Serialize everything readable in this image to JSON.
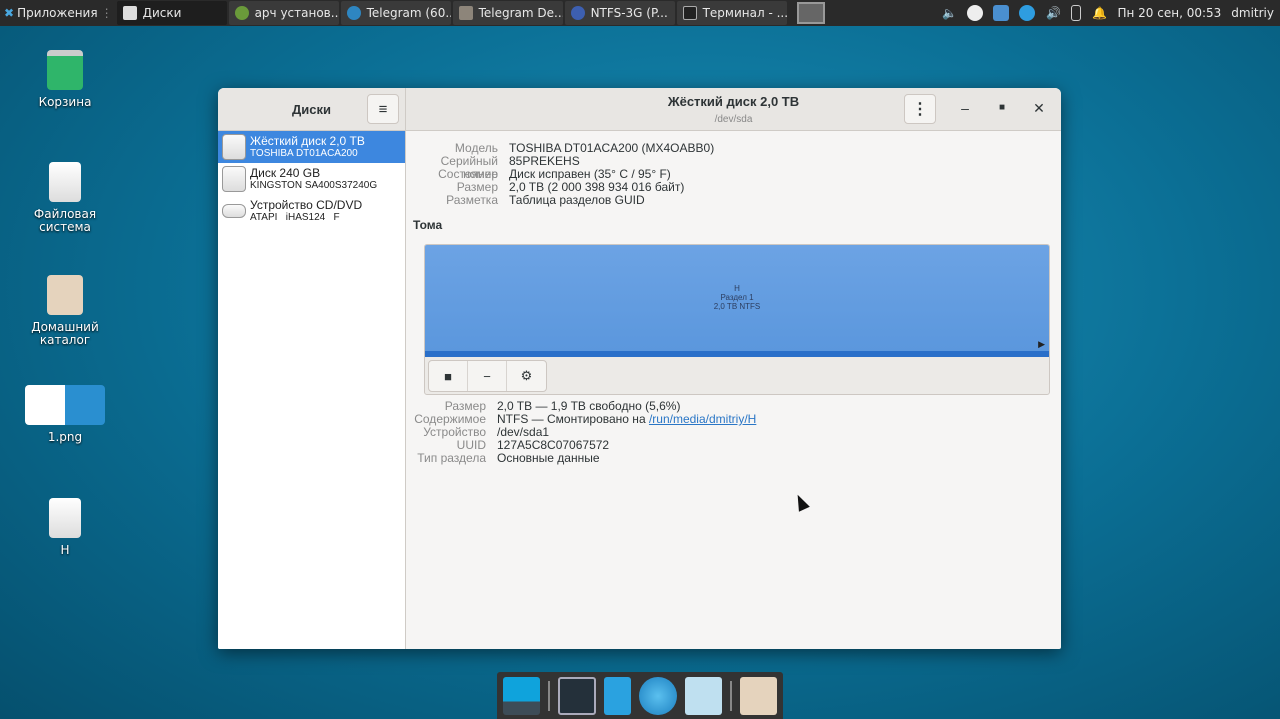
{
  "panel": {
    "apps_menu": "Приложения",
    "tasks": [
      {
        "label": "Диски",
        "icon": "disks-icon",
        "active": true
      },
      {
        "label": "арч установ...",
        "icon": "leaf-icon"
      },
      {
        "label": "Telegram (60...",
        "icon": "telegram-icon"
      },
      {
        "label": "Telegram De...",
        "icon": "folder-icon"
      },
      {
        "label": "NTFS-3G (P...",
        "icon": "browser-icon"
      },
      {
        "label": "Терминал - ...",
        "icon": "terminal-icon"
      }
    ],
    "clock": "Пн 20 сен, 00:53",
    "user": "dmitriy",
    "tray": [
      "volume-icon",
      "shield-icon",
      "network-icon",
      "telegram-icon",
      "speaker-icon",
      "battery-icon",
      "bell-icon"
    ]
  },
  "desktop": {
    "icons": [
      {
        "label": "Корзина"
      },
      {
        "label": "Файловая система"
      },
      {
        "label": "Домашний каталог"
      },
      {
        "label": "1.png"
      },
      {
        "label": "H"
      }
    ]
  },
  "window": {
    "sidebar_title": "Диски",
    "title": "Жёсткий диск 2,0 TB",
    "subtitle": "/dev/sda",
    "drives": [
      {
        "name": "Жёсткий диск 2,0 TB",
        "model": "TOSHIBA DT01ACA200",
        "selected": true
      },
      {
        "name": "Диск 240 GB",
        "model": "KINGSTON SA400S37240G"
      },
      {
        "name": "Устройство CD/DVD",
        "model": "ATAPI   iHAS124   F"
      }
    ],
    "disk_props": [
      {
        "k": "Модель",
        "v": "TOSHIBA DT01ACA200 (MX4OABB0)"
      },
      {
        "k": "Серийный номер",
        "v": "85PREKEHS"
      },
      {
        "k": "Состояние",
        "v": "Диск исправен (35° C / 95° F)"
      },
      {
        "k": "Размер",
        "v": "2,0 TB (2 000 398 934 016 байт)"
      },
      {
        "k": "Разметка",
        "v": "Таблица разделов GUID"
      }
    ],
    "volumes_label": "Тома",
    "partition": {
      "name": "H",
      "label": "Раздел 1",
      "info": "2,0 TB NTFS"
    },
    "vol_props": {
      "size_k": "Размер",
      "size_v": "2,0 TB — 1,9 TB свободно (5,6%)",
      "content_k": "Содержимое",
      "content_v": "NTFS — Смонтировано на ",
      "content_link": "/run/media/dmitriy/H",
      "device_k": "Устройство",
      "device_v": "/dev/sda1",
      "uuid_k": "UUID",
      "uuid_v": "127A5C8C07067572",
      "type_k": "Тип раздела",
      "type_v": "Основные данные"
    }
  },
  "dock": [
    "desktop-icon",
    "terminal-icon",
    "file-cabinet-icon",
    "web-browser-icon",
    "search-icon",
    "folder-icon"
  ]
}
